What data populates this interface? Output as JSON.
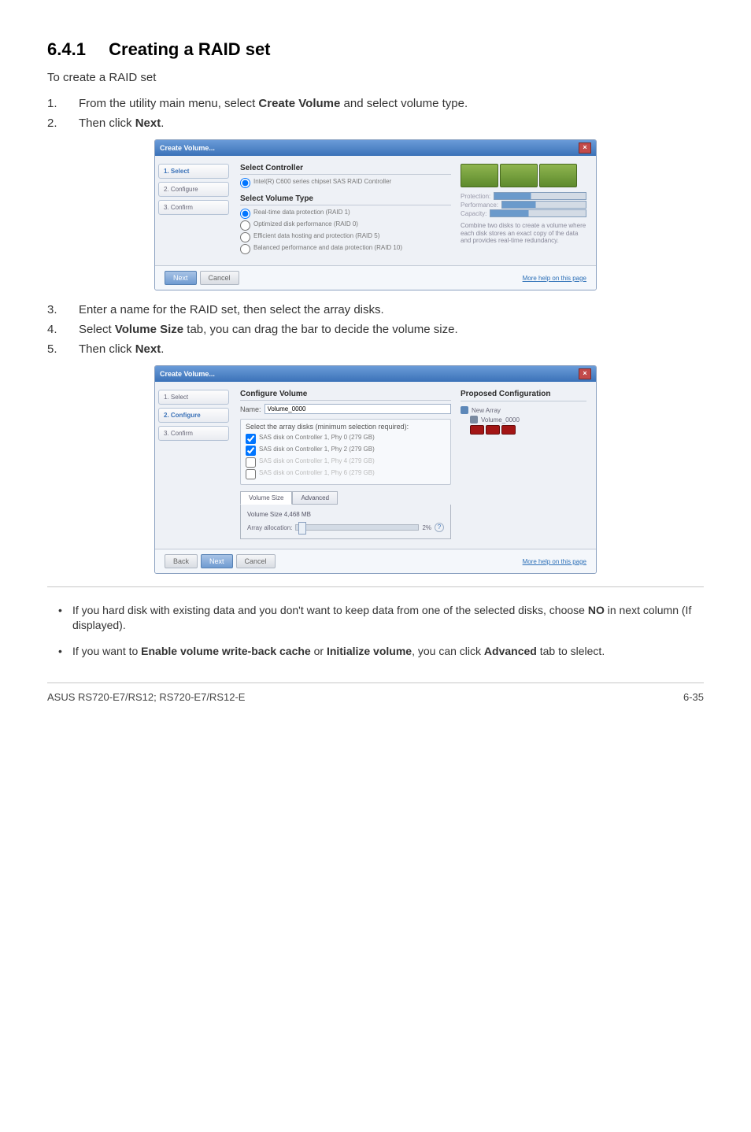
{
  "doc": {
    "section_number": "6.4.1",
    "section_title": "Creating a RAID set",
    "intro": "To create a RAID set",
    "steps_a": [
      {
        "n": "1.",
        "t_prefix": "From the utility main menu, select ",
        "t_bold": "Create Volume",
        "t_suffix": " and select volume type."
      },
      {
        "n": "2.",
        "t_prefix": "Then click ",
        "t_bold": "Next",
        "t_suffix": "."
      }
    ],
    "steps_b": [
      {
        "n": "3.",
        "t": "Enter a name for the RAID set, then select the array disks."
      },
      {
        "n": "4.",
        "t_prefix": "Select ",
        "t_bold": "Volume Size",
        "t_suffix": " tab, you can drag the bar to decide the volume size."
      },
      {
        "n": "5.",
        "t_prefix": "Then click ",
        "t_bold": "Next",
        "t_suffix": "."
      }
    ],
    "notes": [
      {
        "t_prefix": "If you hard disk with existing data and you don't want to keep data from one of the selected disks, choose ",
        "t_bold": "NO",
        "t_suffix": " in next column (If displayed)."
      },
      {
        "t_prefix": "If you want to ",
        "t_bold": "Enable volume write-back cache",
        "t_mid": " or ",
        "t_bold2": "Initialize volume",
        "t_suffix": ", you can click ",
        "t_bold3": "Advanced",
        "t_suffix2": " tab to slelect."
      }
    ],
    "footer_left": "ASUS RS720-E7/RS12; RS720-E7/RS12-E",
    "footer_right": "6-35"
  },
  "dlg1": {
    "title": "Create Volume...",
    "nav": [
      "1. Select",
      "2. Configure",
      "3. Confirm"
    ],
    "h1": "Select Controller",
    "ctrl_radio": "Intel(R) C600 series chipset SAS RAID Controller",
    "h2": "Select Volume Type",
    "opts": [
      "Real-time data protection (RAID 1)",
      "Optimized disk performance (RAID 0)",
      "Efficient data hosting and protection (RAID 5)",
      "Balanced performance and data protection (RAID 10)"
    ],
    "kv": {
      "protection": "Protection:",
      "performance": "Performance:",
      "capacity": "Capacity:"
    },
    "hint": "Combine two disks to create a volume where each disk stores an exact copy of the data and provides real-time redundancy.",
    "btn_next": "Next",
    "btn_cancel": "Cancel",
    "help": "More help on this page"
  },
  "dlg2": {
    "title": "Create Volume...",
    "nav": [
      "1. Select",
      "2. Configure",
      "3. Confirm"
    ],
    "h1": "Configure Volume",
    "name_label": "Name:",
    "name_value": "Volume_0000",
    "sel_text": "Select the array disks (minimum selection required):",
    "disks": [
      "SAS disk on Controller 1, Phy 0 (279 GB)",
      "SAS disk on Controller 1, Phy 2 (279 GB)",
      "SAS disk on Controller 1, Phy 4 (279 GB)",
      "SAS disk on Controller 1, Phy 6 (279 GB)"
    ],
    "tab_vol": "Volume Size",
    "tab_adv": "Advanced",
    "vol_label": "Volume Size 4,468 MB",
    "alloc_label": "Array allocation:",
    "alloc_val": "2% ",
    "right_h": "Proposed Configuration",
    "array_label": "New Array",
    "vol_chip": "Volume_0000",
    "btn_back": "Back",
    "btn_next": "Next",
    "btn_cancel": "Cancel",
    "help": "More help on this page"
  }
}
